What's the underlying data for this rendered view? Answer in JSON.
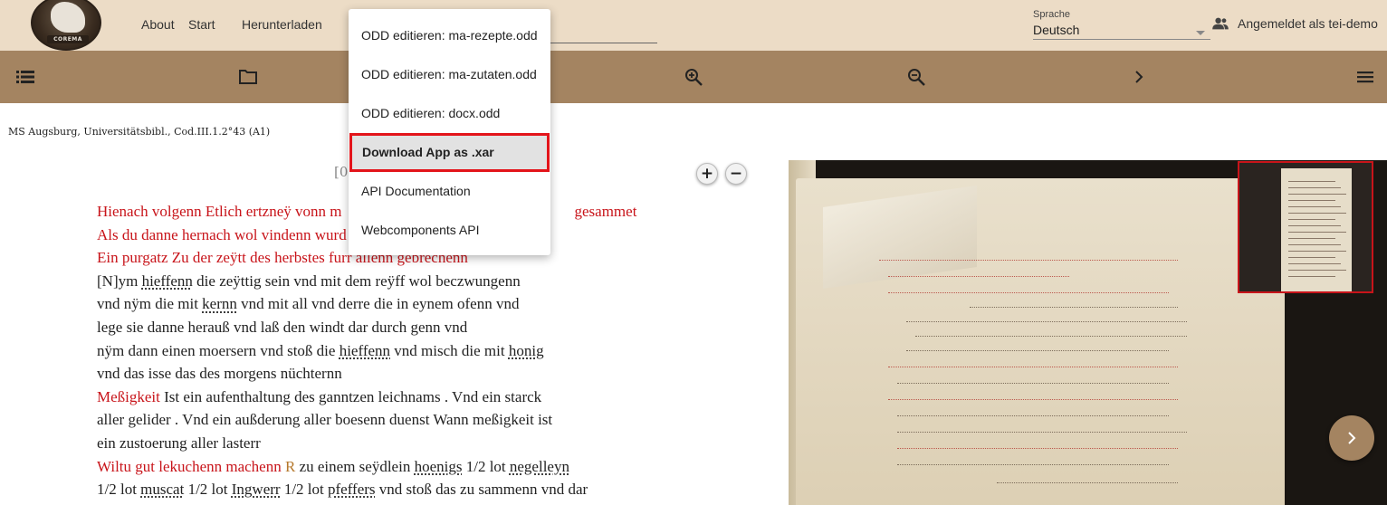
{
  "header": {
    "logo_text": "COREMA",
    "nav": {
      "about": "About",
      "start": "Start",
      "download": "Herunterladen"
    },
    "language": {
      "label": "Sprache",
      "value": "Deutsch"
    },
    "user": "Angemeldet als tei-demo"
  },
  "menu": {
    "items": [
      "ODD editieren: ma-rezepte.odd",
      "ODD editieren: ma-zutaten.odd",
      "ODD editieren: docx.odd",
      "Download App as .xar",
      "API Documentation",
      "Webcomponents API"
    ],
    "highlighted_index": 3
  },
  "toolbar": {
    "icons": [
      "list-icon",
      "folder-icon",
      "zoom-in-icon",
      "zoom-out-icon",
      "chevron-right-icon",
      "menu-icon"
    ]
  },
  "document": {
    "title": "MS Augsburg, Universitätsbibl., Cod.III.1.2°43 (A1)",
    "page_ref": "[00",
    "lines": [
      [
        {
          "t": "Hienach volgenn Etlich ertzneÿ vonn m",
          "c": "red"
        },
        {
          "t": "gesammet",
          "c": "red",
          "gap": true
        }
      ],
      [
        {
          "t": "Als du danne hernach wol vindenn wurd",
          "c": "red"
        }
      ],
      [
        {
          "t": "Ein purgatz Zu der zeÿtt des herbstes furr allenn gebrechenn",
          "c": "red"
        }
      ],
      [
        {
          "t": "[N]ym "
        },
        {
          "t": "hieffenn",
          "u": true
        },
        {
          "t": " die zeÿttig sein vnd mit dem reÿff wol beczwungenn"
        }
      ],
      [
        {
          "t": "vnd nÿm die mit "
        },
        {
          "t": "kernn",
          "u": true
        },
        {
          "t": " vnd mit all vnd derre die in eynem ofenn vnd"
        }
      ],
      [
        {
          "t": "lege sie danne herauß vnd laß den windt dar durch genn vnd"
        }
      ],
      [
        {
          "t": "nÿm dann einen moersern vnd stoß die "
        },
        {
          "t": "hieffenn",
          "u": true
        },
        {
          "t": " vnd misch die mit "
        },
        {
          "t": "honig",
          "u": true
        }
      ],
      [
        {
          "t": "vnd das isse das des morgens nüchternn"
        }
      ],
      [
        {
          "t": "Meßigkeit",
          "c": "red"
        },
        {
          "t": " Ist ein aufenthaltung des ganntzen leichnams . Vnd ein starck"
        }
      ],
      [
        {
          "t": "aller gelider . Vnd ein außderung aller boesenn duenst Wann meßigkeit ist"
        }
      ],
      [
        {
          "t": "ein zustoerung aller lasterr"
        }
      ],
      [
        {
          "t": "Wiltu gut lekuchenn machenn",
          "c": "red"
        },
        {
          "t": " R",
          "c": "brown"
        },
        {
          "t": " zu einem seÿdlein "
        },
        {
          "t": "hoenigs",
          "u": true
        },
        {
          "t": " 1/2 lot "
        },
        {
          "t": "negelleyn",
          "u": true
        }
      ],
      [
        {
          "t": "1/2 lot "
        },
        {
          "t": "muscat",
          "u": true
        },
        {
          "t": " 1/2 lot "
        },
        {
          "t": "Ingwerr",
          "u": true
        },
        {
          "t": " 1/2 lot "
        },
        {
          "t": "pfeffers",
          "u": true
        },
        {
          "t": " vnd stoß das zu sammenn vnd dar"
        }
      ]
    ]
  },
  "colors": {
    "header_bg": "#ecdcc6",
    "toolbar_bg": "#a48461",
    "rubric_red": "#c8141a",
    "highlight_border": "#e3141a"
  }
}
